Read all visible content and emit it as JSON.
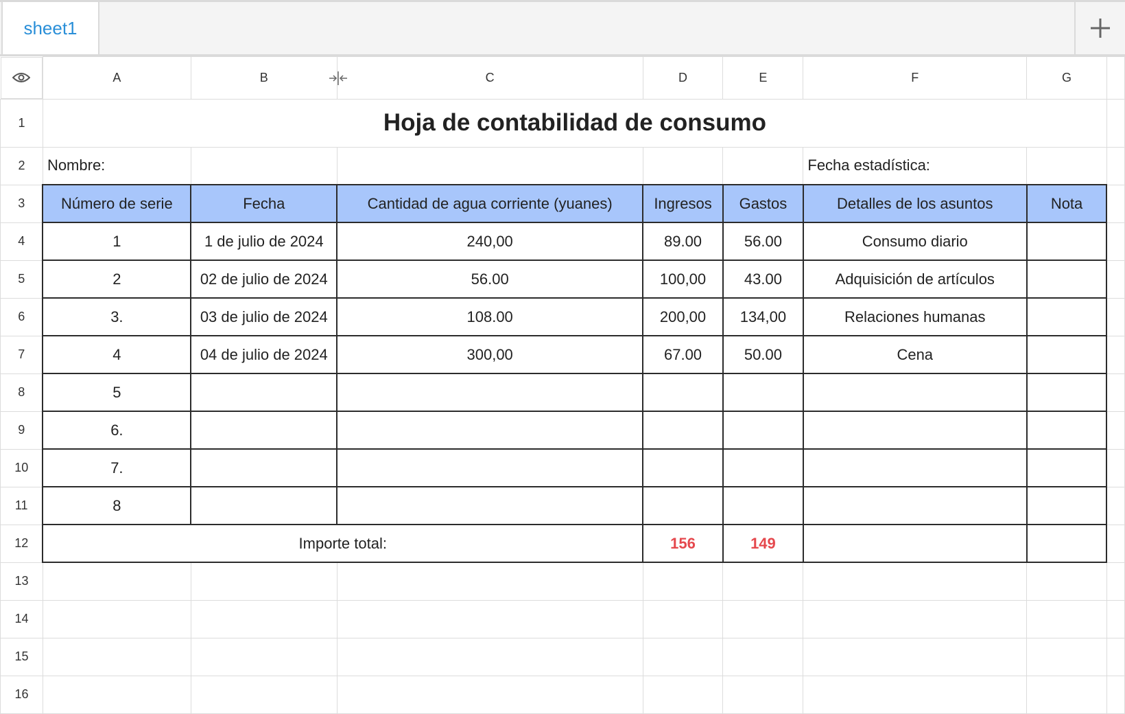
{
  "tabs": {
    "sheet_name": "sheet1"
  },
  "columns": [
    "A",
    "B",
    "C",
    "D",
    "E",
    "F",
    "G"
  ],
  "rows": [
    "1",
    "2",
    "3",
    "4",
    "5",
    "6",
    "7",
    "8",
    "9",
    "10",
    "11",
    "12",
    "13",
    "14",
    "15",
    "16"
  ],
  "sheet": {
    "title": "Hoja de contabilidad de consumo",
    "name_label": "Nombre:",
    "date_label": "Fecha estadística:",
    "headers": [
      "Número de serie",
      "Fecha",
      "Cantidad de agua corriente (yuanes)",
      "Ingresos",
      "Gastos",
      "Detalles de los asuntos",
      "Nota"
    ],
    "data": [
      [
        "1",
        "1 de julio de 2024",
        "240,00",
        "89.00",
        "56.00",
        "Consumo diario",
        ""
      ],
      [
        "2",
        "02 de julio de 2024",
        "56.00",
        "100,00",
        "43.00",
        "Adquisición de artículos",
        ""
      ],
      [
        "3.",
        "03 de julio de 2024",
        "108.00",
        "200,00",
        "134,00",
        "Relaciones humanas",
        ""
      ],
      [
        "4",
        "04 de julio de 2024",
        "300,00",
        "67.00",
        "50.00",
        "Cena",
        ""
      ],
      [
        "5",
        "",
        "",
        "",
        "",
        "",
        ""
      ],
      [
        "6.",
        "",
        "",
        "",
        "",
        "",
        ""
      ],
      [
        "7.",
        "",
        "",
        "",
        "",
        "",
        ""
      ],
      [
        "8",
        "",
        "",
        "",
        "",
        "",
        ""
      ]
    ],
    "total_label": "Importe total:",
    "total_income": "156",
    "total_expense": "149"
  },
  "colors": {
    "header_fill": "#a8c6fb",
    "total_text": "#e5484d",
    "tab_text": "#2a8fd8"
  },
  "icons": [
    "eye-icon",
    "plus-icon",
    "column-resize-icon"
  ]
}
